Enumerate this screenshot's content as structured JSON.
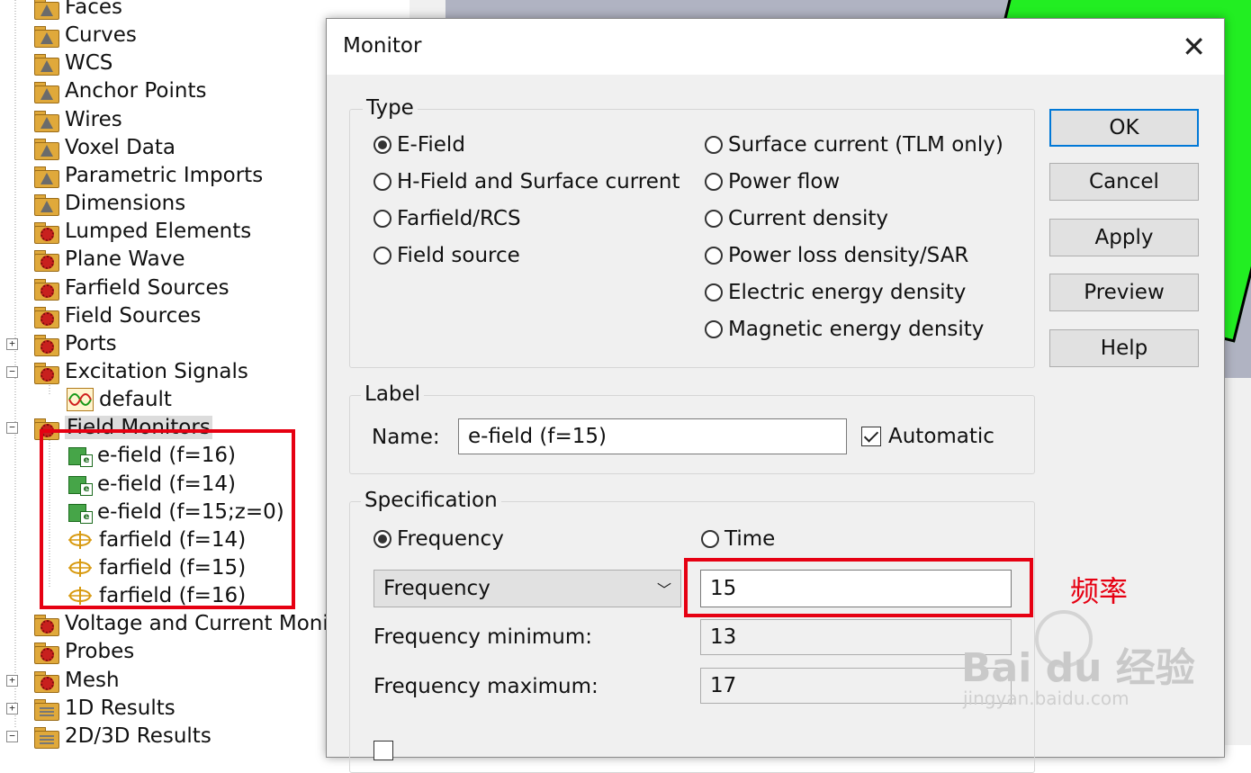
{
  "tree": {
    "items": [
      {
        "label": "Faces",
        "icon": "folder-triangle-icon"
      },
      {
        "label": "Curves",
        "icon": "folder-triangle-icon"
      },
      {
        "label": "WCS",
        "icon": "folder-triangle-icon"
      },
      {
        "label": "Anchor Points",
        "icon": "folder-triangle-icon"
      },
      {
        "label": "Wires",
        "icon": "folder-triangle-icon"
      },
      {
        "label": "Voxel Data",
        "icon": "folder-triangle-icon"
      },
      {
        "label": "Parametric Imports",
        "icon": "folder-triangle-icon"
      },
      {
        "label": "Dimensions",
        "icon": "folder-triangle-icon"
      },
      {
        "label": "Lumped Elements",
        "icon": "folder-gear-icon"
      },
      {
        "label": "Plane Wave",
        "icon": "folder-gear-icon"
      },
      {
        "label": "Farfield Sources",
        "icon": "folder-gear-icon"
      },
      {
        "label": "Field Sources",
        "icon": "folder-gear-icon"
      },
      {
        "label": "Ports",
        "icon": "folder-gear-icon"
      },
      {
        "label": "Excitation Signals",
        "icon": "folder-gear-icon"
      },
      {
        "label": "default",
        "icon": "signal-icon"
      },
      {
        "label": "Field Monitors",
        "icon": "folder-gear-icon"
      },
      {
        "label": "e-field (f=16)",
        "icon": "efield-monitor-icon"
      },
      {
        "label": "e-field (f=14)",
        "icon": "efield-monitor-icon"
      },
      {
        "label": "e-field (f=15;z=0)",
        "icon": "efield-monitor-icon"
      },
      {
        "label": "farfield (f=14)",
        "icon": "farfield-monitor-icon"
      },
      {
        "label": "farfield (f=15)",
        "icon": "farfield-monitor-icon"
      },
      {
        "label": "farfield (f=16)",
        "icon": "farfield-monitor-icon"
      },
      {
        "label": "Voltage and Current Monit",
        "icon": "folder-gear-icon"
      },
      {
        "label": "Probes",
        "icon": "folder-gear-icon"
      },
      {
        "label": "Mesh",
        "icon": "folder-gear-icon"
      },
      {
        "label": "1D Results",
        "icon": "folder-stack-icon"
      },
      {
        "label": "2D/3D Results",
        "icon": "folder-stack-icon"
      }
    ]
  },
  "dialog": {
    "title": "Monitor",
    "type_group": {
      "label": "Type",
      "options": [
        {
          "label": "E-Field",
          "checked": true
        },
        {
          "label": "H-Field and Surface current",
          "checked": false
        },
        {
          "label": "Farfield/RCS",
          "checked": false
        },
        {
          "label": "Field source",
          "checked": false
        },
        {
          "label": "Surface current (TLM only)",
          "checked": false
        },
        {
          "label": "Power flow",
          "checked": false
        },
        {
          "label": "Current density",
          "checked": false
        },
        {
          "label": "Power loss density/SAR",
          "checked": false
        },
        {
          "label": "Electric energy density",
          "checked": false
        },
        {
          "label": "Magnetic energy density",
          "checked": false
        }
      ]
    },
    "label_group": {
      "label": "Label",
      "name_label": "Name:",
      "name_value": "e-field (f=15)",
      "automatic_label": "Automatic",
      "automatic_checked": true
    },
    "spec_group": {
      "label": "Specification",
      "frequency_radio": "Frequency",
      "time_radio": "Time",
      "domain_selected": "Frequency",
      "select_value": "Frequency",
      "frequency_value": "15",
      "freq_min_label": "Frequency minimum:",
      "freq_min_value": "13",
      "freq_max_label": "Frequency maximum:",
      "freq_max_value": "17"
    },
    "buttons": {
      "ok": "OK",
      "cancel": "Cancel",
      "apply": "Apply",
      "preview": "Preview",
      "help": "Help"
    }
  },
  "annotation": {
    "text": "频率",
    "color": "#e60012"
  },
  "watermark": {
    "main": "Bai du 经验",
    "sub": "jingyan.baidu.com"
  },
  "colors": {
    "highlight_box": "#e60012",
    "default_button_border": "#0078d7",
    "viewport_green": "#22ee22"
  }
}
